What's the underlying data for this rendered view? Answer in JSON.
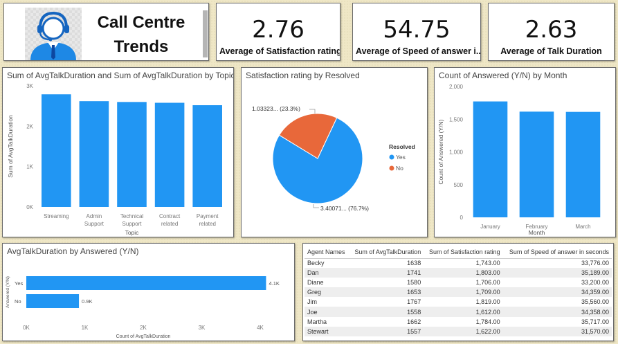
{
  "header": {
    "title_line1": "Call Centre",
    "title_line2": "Trends",
    "logo_icon": "call-center-agent-icon"
  },
  "kpis": [
    {
      "value": "2.76",
      "label": "Average of Satisfaction rating"
    },
    {
      "value": "54.75",
      "label": "Average of Speed of answer i..."
    },
    {
      "value": "2.63",
      "label": "Average of Talk Duration"
    }
  ],
  "colors": {
    "blue": "#2196f3",
    "orange": "#e8683a"
  },
  "chart_data": [
    {
      "type": "bar",
      "title": "Sum of AvgTalkDuration and Sum of AvgTalkDuration by Topic",
      "xlabel": "Topic",
      "ylabel": "Sum of AvgTalkDuration",
      "categories": [
        [
          "Streaming"
        ],
        [
          "Admin",
          "Support"
        ],
        [
          "Technical",
          "Support"
        ],
        [
          "Contract",
          "related"
        ],
        [
          "Payment",
          "related"
        ]
      ],
      "values": [
        2790,
        2620,
        2600,
        2580,
        2520
      ],
      "yticks": [
        "0K",
        "1K",
        "2K",
        "3K"
      ],
      "ylim": [
        0,
        3000
      ]
    },
    {
      "type": "pie",
      "title": "Satisfaction rating by Resolved",
      "legend_title": "Resolved",
      "slices": [
        {
          "label": "Yes",
          "value": 3.40071,
          "percent": 76.7,
          "data_label": "3.40071... (76.7%)"
        },
        {
          "label": "No",
          "value": 1.03323,
          "percent": 23.3,
          "data_label": "1.03323... (23.3%)"
        }
      ]
    },
    {
      "type": "bar",
      "title": "Count of Answered (Y/N) by Month",
      "xlabel": "Month",
      "ylabel": "Count of Answered (Y/N)",
      "categories": [
        "January",
        "February",
        "March"
      ],
      "values": [
        1772,
        1616,
        1612
      ],
      "yticks": [
        "0",
        "500",
        "1,000",
        "1,500",
        "2,000"
      ],
      "ylim": [
        0,
        2000
      ]
    },
    {
      "type": "bar",
      "orientation": "horizontal",
      "title": "AvgTalkDuration by Answered (Y/N)",
      "xlabel": "Count of AvgTalkDuration",
      "ylabel": "Answered (Y/N)",
      "categories": [
        "Yes",
        "No"
      ],
      "values": [
        4100,
        900
      ],
      "data_labels": [
        "4.1K",
        "0.9K"
      ],
      "xticks": [
        "0K",
        "1K",
        "2K",
        "3K",
        "4K"
      ],
      "xlim": [
        0,
        4000
      ]
    },
    {
      "type": "table",
      "columns": [
        "Agent Names",
        "Sum of AvgTalkDuration",
        "Sum of Satisfaction rating",
        "Sum of Speed of answer in seconds"
      ],
      "rows": [
        [
          "Becky",
          "1638",
          "1,743.00",
          "33,776.00"
        ],
        [
          "Dan",
          "1741",
          "1,803.00",
          "35,189.00"
        ],
        [
          "Diane",
          "1580",
          "1,706.00",
          "33,200.00"
        ],
        [
          "Greg",
          "1653",
          "1,709.00",
          "34,359.00"
        ],
        [
          "Jim",
          "1767",
          "1,819.00",
          "35,560.00"
        ],
        [
          "Joe",
          "1558",
          "1,612.00",
          "34,358.00"
        ],
        [
          "Martha",
          "1662",
          "1,784.00",
          "35,717.00"
        ],
        [
          "Stewart",
          "1557",
          "1,622.00",
          "31,570.00"
        ]
      ]
    }
  ]
}
